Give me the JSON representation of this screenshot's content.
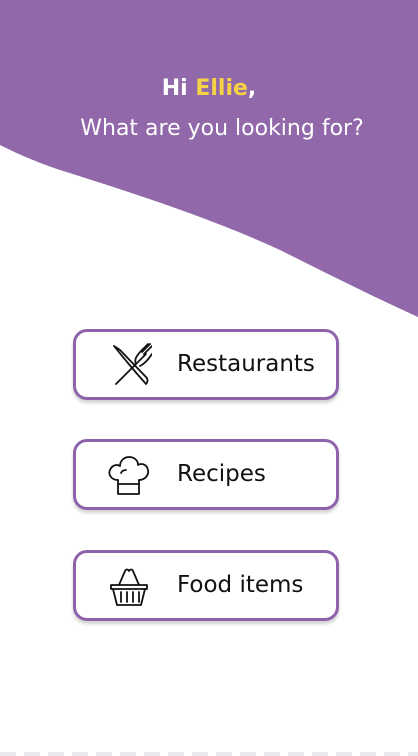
{
  "header": {
    "greeting_prefix": "Hi ",
    "user_name": "Ellie",
    "greeting_suffix": ",",
    "question": "What are you looking for?",
    "name_color": "#f6d247",
    "background_color": "#9168a9"
  },
  "options": [
    {
      "label": "Restaurants",
      "icon": "fork-knife-icon"
    },
    {
      "label": "Recipes",
      "icon": "chef-hat-icon"
    },
    {
      "label": "Food items",
      "icon": "shopping-basket-icon"
    }
  ],
  "accent_color": "#8e63ab"
}
